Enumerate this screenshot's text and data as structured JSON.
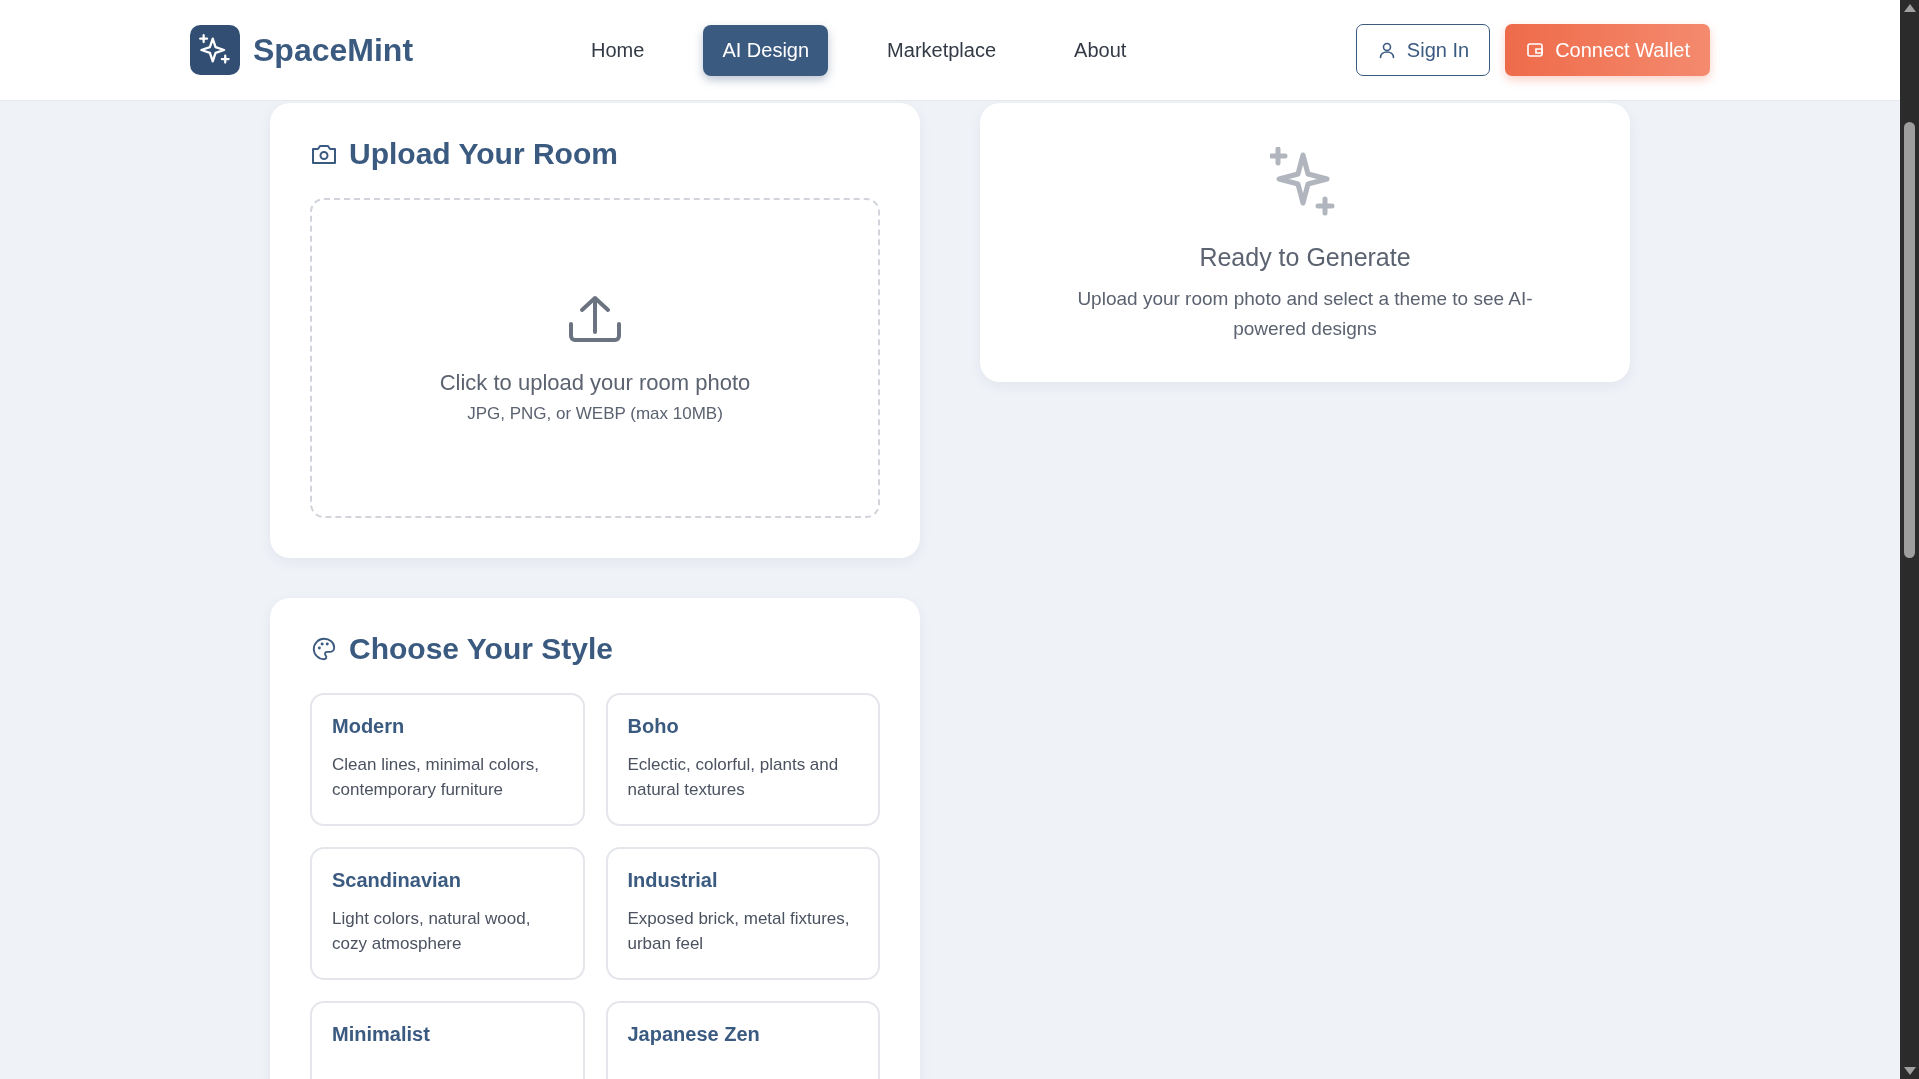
{
  "brand": {
    "name": "SpaceMint"
  },
  "nav": [
    {
      "label": "Home",
      "selected": false
    },
    {
      "label": "AI Design",
      "selected": true
    },
    {
      "label": "Marketplace",
      "selected": false
    },
    {
      "label": "About",
      "selected": false
    }
  ],
  "actions": {
    "sign_in": "Sign In",
    "connect_wallet": "Connect Wallet"
  },
  "upload": {
    "title": "Upload Your Room",
    "prompt": "Click to upload your room photo",
    "hint": "JPG, PNG, or WEBP (max 10MB)"
  },
  "result": {
    "title": "Ready to Generate",
    "message": "Upload your room photo and select a theme to see AI-powered designs"
  },
  "styles": {
    "title": "Choose Your Style",
    "options": [
      {
        "name": "Modern",
        "description": "Clean lines, minimal colors, contemporary furniture",
        "selected": false
      },
      {
        "name": "Boho",
        "description": "Eclectic, colorful, plants and natural textures",
        "selected": false
      },
      {
        "name": "Scandinavian",
        "description": "Light colors, natural wood, cozy atmosphere",
        "selected": false
      },
      {
        "name": "Industrial",
        "description": "Exposed brick, metal fixtures, urban feel",
        "selected": false
      },
      {
        "name": "Minimalist",
        "selected": false
      },
      {
        "name": "Japanese Zen",
        "selected": false
      }
    ]
  }
}
